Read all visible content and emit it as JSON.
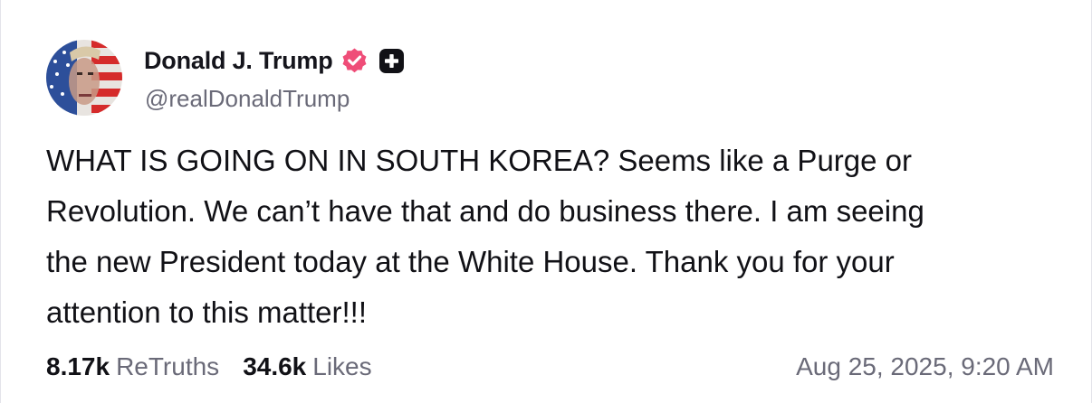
{
  "post": {
    "author": {
      "display_name": "Donald J. Trump",
      "handle": "@realDonaldTrump",
      "verified_icon": "verified-badge-icon",
      "extra_icon": "plus-badge-icon",
      "avatar": "profile-avatar"
    },
    "text": "WHAT IS GOING ON IN SOUTH KOREA? Seems like a Purge or\nRevolution. We can’t have that and do business there. I am seeing\nthe new President today at the White House. Thank you for your\nattention to this matter!!!",
    "stats": {
      "retruths_count": "8.17k",
      "retruths_label": "ReTruths",
      "likes_count": "34.6k",
      "likes_label": "Likes"
    },
    "timestamp": "Aug 25, 2025, 9:20 AM"
  },
  "colors": {
    "verified": "#ef4d78",
    "text": "#111116",
    "muted": "#6a6a78",
    "border": "#e4e4ea"
  }
}
